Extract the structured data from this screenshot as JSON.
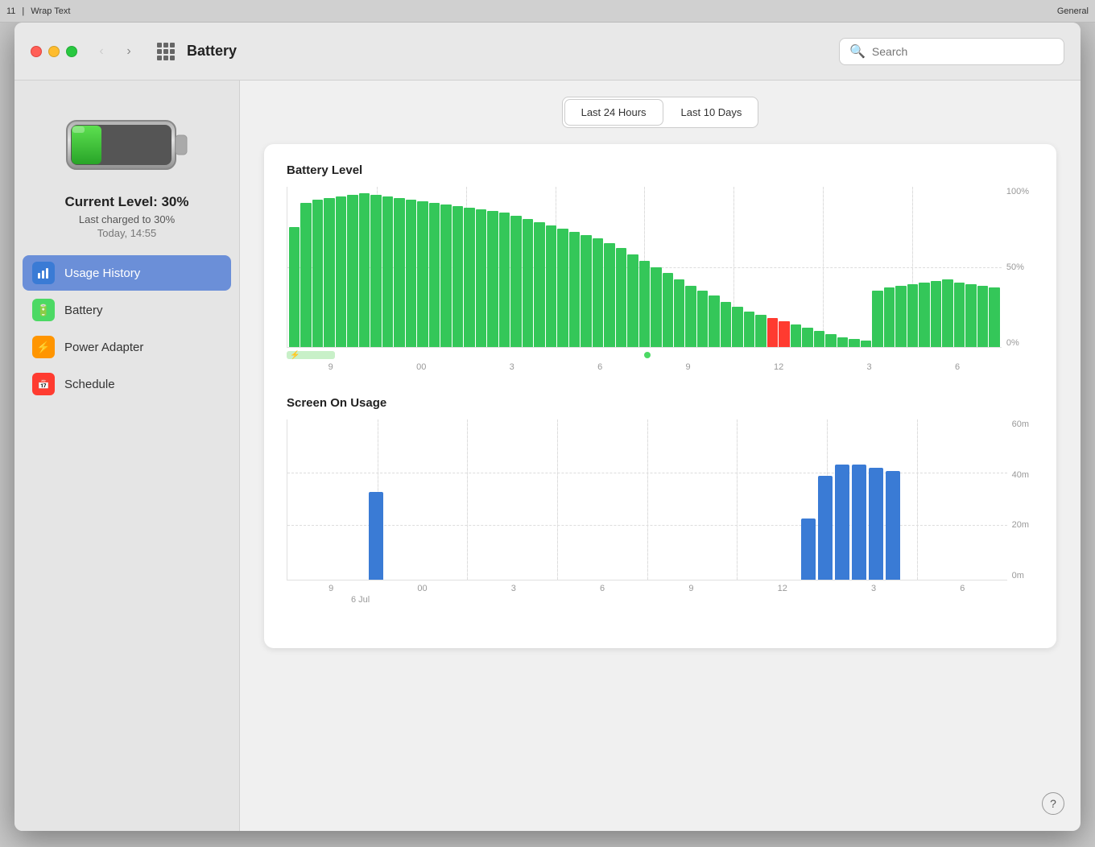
{
  "toolbar": {
    "font_size": "11",
    "wrap_text_label": "Wrap Text",
    "general_label": "General"
  },
  "window": {
    "title": "Battery",
    "search_placeholder": "Search"
  },
  "sidebar": {
    "battery_icon_alt": "Battery icon",
    "current_level": "Current Level: 30%",
    "last_charged": "Last charged to 30%",
    "time": "Today, 14:55",
    "nav_items": [
      {
        "id": "usage-history",
        "label": "Usage History",
        "icon": "📊",
        "active": true,
        "icon_class": "icon-usage"
      },
      {
        "id": "battery",
        "label": "Battery",
        "icon": "🔋",
        "active": false,
        "icon_class": "icon-battery"
      },
      {
        "id": "power-adapter",
        "label": "Power Adapter",
        "icon": "⚡",
        "active": false,
        "icon_class": "icon-power"
      },
      {
        "id": "schedule",
        "label": "Schedule",
        "icon": "📅",
        "active": false,
        "icon_class": "icon-schedule"
      }
    ]
  },
  "time_toggle": {
    "options": [
      "Last 24 Hours",
      "Last 10 Days"
    ],
    "active": "Last 24 Hours"
  },
  "battery_chart": {
    "title": "Battery Level",
    "y_labels": [
      "100%",
      "50%",
      "0%"
    ],
    "x_labels": [
      "9",
      "00",
      "3",
      "6",
      "9",
      "12",
      "3",
      "6"
    ],
    "bars": [
      75,
      90,
      92,
      93,
      94,
      95,
      96,
      95,
      94,
      93,
      92,
      91,
      90,
      89,
      88,
      87,
      86,
      85,
      84,
      82,
      80,
      78,
      76,
      74,
      72,
      70,
      68,
      65,
      62,
      58,
      54,
      50,
      46,
      42,
      38,
      35,
      32,
      28,
      25,
      22,
      20,
      18,
      16,
      14,
      12,
      10,
      8,
      6,
      5,
      4,
      35,
      37,
      38,
      39,
      40,
      41,
      42,
      40,
      39,
      38,
      37
    ],
    "charging_width": 80,
    "charging_dot_color": "#4cd964"
  },
  "screen_chart": {
    "title": "Screen On Usage",
    "y_labels": [
      "60m",
      "40m",
      "20m",
      "0m"
    ],
    "x_labels": [
      "9",
      "00",
      "3",
      "6",
      "9",
      "12",
      "3",
      "6"
    ],
    "date_label": "6 Jul",
    "bars": [
      {
        "height": 0,
        "width": 1
      },
      {
        "height": 0.55,
        "width": 1
      },
      {
        "height": 0,
        "width": 1
      },
      {
        "height": 0,
        "width": 1
      },
      {
        "height": 0,
        "width": 1
      },
      {
        "height": 0.38,
        "width": 1
      },
      {
        "height": 0.65,
        "width": 1
      },
      {
        "height": 0.72,
        "width": 1
      },
      {
        "height": 0.7,
        "width": 1
      },
      {
        "height": 0.68,
        "width": 1
      },
      {
        "height": 0,
        "width": 1
      }
    ]
  },
  "help": {
    "label": "?"
  }
}
